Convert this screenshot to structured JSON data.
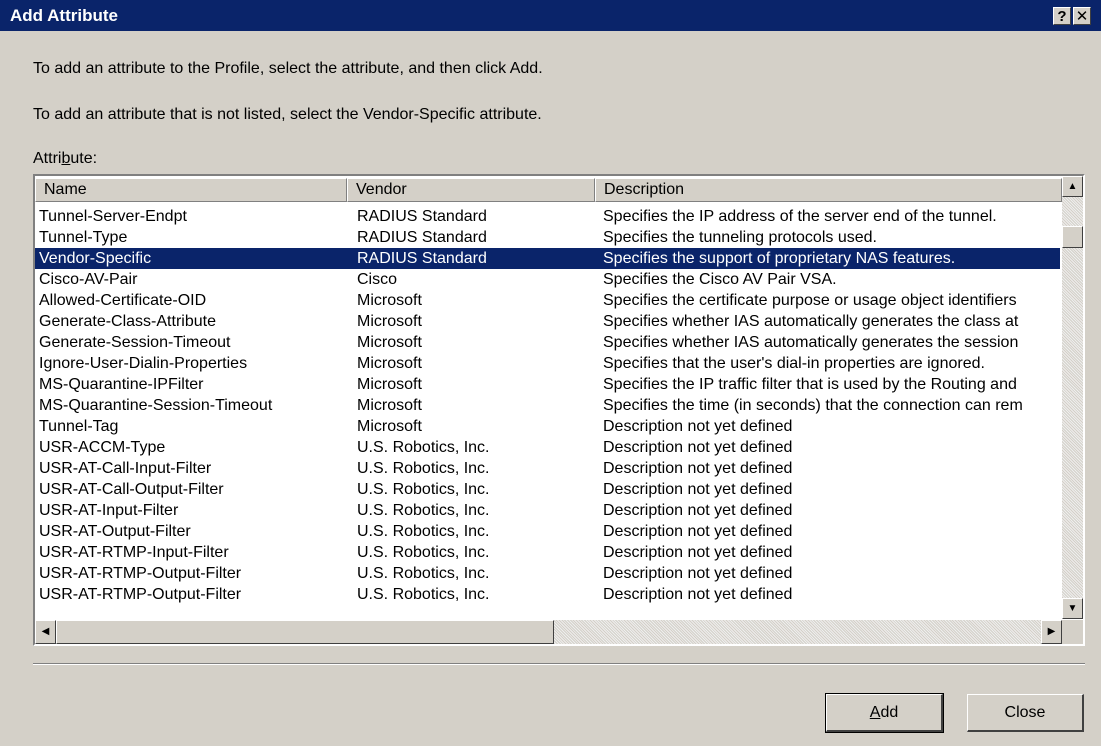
{
  "window": {
    "title": "Add Attribute",
    "help_label": "?",
    "close_label": "✕"
  },
  "instructions": {
    "line1": "To add an attribute to the Profile, select the attribute, and then click Add.",
    "line2": "To add an attribute that is not listed, select the Vendor-Specific attribute."
  },
  "list_label": "Attribute:",
  "columns": {
    "name": "Name",
    "vendor": "Vendor",
    "description": "Description"
  },
  "rows": [
    {
      "name": "Tunnel-Server-Endpt",
      "vendor": "RADIUS Standard",
      "description": "Specifies the IP address of the server end of the tunnel."
    },
    {
      "name": "Tunnel-Type",
      "vendor": "RADIUS Standard",
      "description": "Specifies the tunneling protocols used."
    },
    {
      "name": "Vendor-Specific",
      "vendor": "RADIUS Standard",
      "description": "Specifies the support of proprietary NAS features.",
      "selected": true
    },
    {
      "name": "Cisco-AV-Pair",
      "vendor": "Cisco",
      "description": "Specifies the Cisco AV Pair VSA."
    },
    {
      "name": "Allowed-Certificate-OID",
      "vendor": "Microsoft",
      "description": "Specifies the certificate purpose or usage object identifiers"
    },
    {
      "name": "Generate-Class-Attribute",
      "vendor": "Microsoft",
      "description": "Specifies whether IAS automatically generates the class at"
    },
    {
      "name": "Generate-Session-Timeout",
      "vendor": "Microsoft",
      "description": "Specifies whether IAS automatically generates the session"
    },
    {
      "name": "Ignore-User-Dialin-Properties",
      "vendor": "Microsoft",
      "description": "Specifies that the user's dial-in properties are ignored."
    },
    {
      "name": "MS-Quarantine-IPFilter",
      "vendor": "Microsoft",
      "description": "Specifies the IP traffic filter that is used by the Routing and"
    },
    {
      "name": "MS-Quarantine-Session-Timeout",
      "vendor": "Microsoft",
      "description": "Specifies the time (in seconds) that the connection can rem"
    },
    {
      "name": "Tunnel-Tag",
      "vendor": "Microsoft",
      "description": "Description not yet defined"
    },
    {
      "name": "USR-ACCM-Type",
      "vendor": "U.S. Robotics, Inc.",
      "description": "Description not yet defined"
    },
    {
      "name": "USR-AT-Call-Input-Filter",
      "vendor": "U.S. Robotics, Inc.",
      "description": "Description not yet defined"
    },
    {
      "name": "USR-AT-Call-Output-Filter",
      "vendor": "U.S. Robotics, Inc.",
      "description": "Description not yet defined"
    },
    {
      "name": "USR-AT-Input-Filter",
      "vendor": "U.S. Robotics, Inc.",
      "description": "Description not yet defined"
    },
    {
      "name": "USR-AT-Output-Filter",
      "vendor": "U.S. Robotics, Inc.",
      "description": "Description not yet defined"
    },
    {
      "name": "USR-AT-RTMP-Input-Filter",
      "vendor": "U.S. Robotics, Inc.",
      "description": "Description not yet defined"
    },
    {
      "name": "USR-AT-RTMP-Output-Filter",
      "vendor": "U.S. Robotics, Inc.",
      "description": "Description not yet defined"
    },
    {
      "name": "USR-AT-RTMP-Output-Filter",
      "vendor": "U.S. Robotics, Inc.",
      "description": "Description not yet defined"
    }
  ],
  "buttons": {
    "add": "Add",
    "close": "Close"
  },
  "colors": {
    "titlebar": "#0a246a",
    "selection": "#0a246a",
    "face": "#d4d0c8"
  }
}
